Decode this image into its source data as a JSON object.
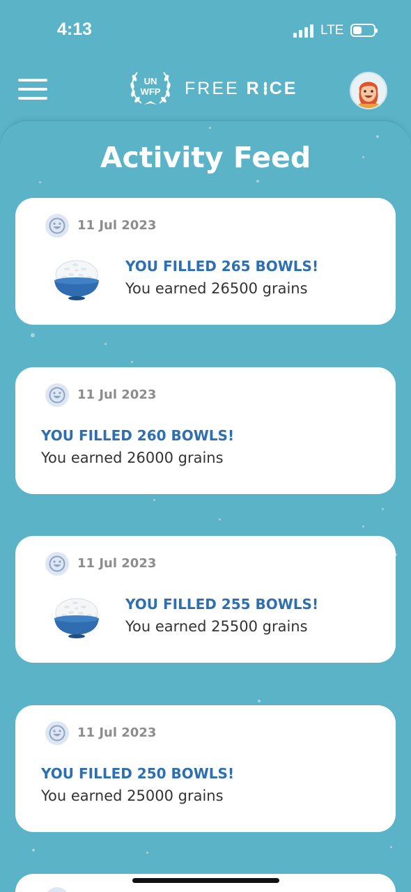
{
  "status": {
    "time": "4:13",
    "network": "LTE"
  },
  "header": {
    "logo_un_line1": "UN",
    "logo_un_line2": "WFP",
    "logo_free": "FREE",
    "logo_rice": "R",
    "logo_rice_rest": "CE"
  },
  "page": {
    "title": "Activity Feed"
  },
  "feed": [
    {
      "date": "11 Jul 2023",
      "title": "YOU FILLED 265 BOWLS!",
      "subtitle": "You earned 26500 grains",
      "has_bowl": true
    },
    {
      "date": "11 Jul 2023",
      "title": "YOU FILLED 260 BOWLS!",
      "subtitle": "You earned 26000 grains",
      "has_bowl": false
    },
    {
      "date": "11 Jul 2023",
      "title": "YOU FILLED 255 BOWLS!",
      "subtitle": "You earned 25500 grains",
      "has_bowl": true
    },
    {
      "date": "11 Jul 2023",
      "title": "YOU FILLED 250 BOWLS!",
      "subtitle": "You earned 25000 grains",
      "has_bowl": false
    }
  ],
  "colors": {
    "background": "#5bb3c7",
    "accent_text": "#2d6fb0",
    "card": "#ffffff"
  },
  "icons": [
    "menu-icon",
    "wreath-icon",
    "avatar-icon",
    "smile-icon",
    "rice-bowl-icon"
  ]
}
